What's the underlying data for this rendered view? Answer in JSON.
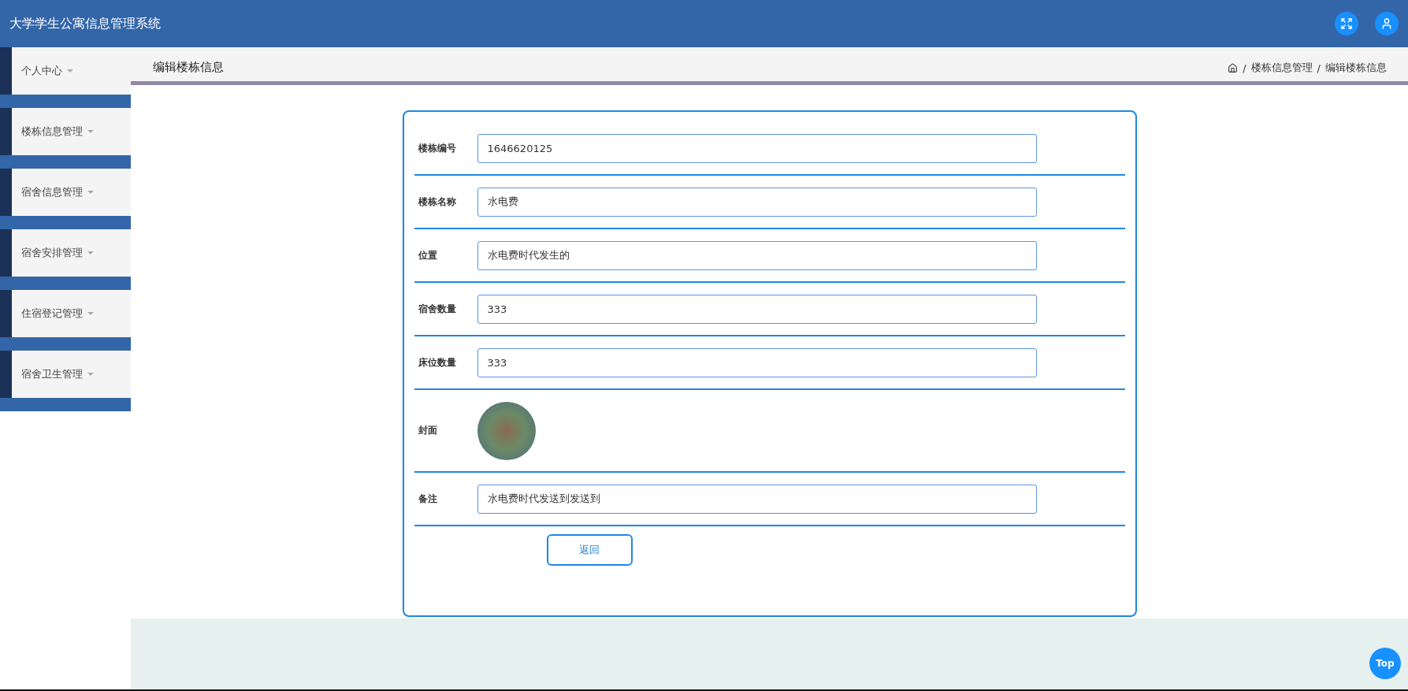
{
  "header": {
    "title": "大学学生公寓信息管理系统"
  },
  "sidebar": {
    "items": [
      {
        "label": "个人中心"
      },
      {
        "label": "楼栋信息管理"
      },
      {
        "label": "宿舍信息管理"
      },
      {
        "label": "宿舍安排管理"
      },
      {
        "label": "住宿登记管理"
      },
      {
        "label": "宿舍卫生管理"
      }
    ]
  },
  "page_title": "编辑楼栋信息",
  "breadcrumb": [
    {
      "separator": "/",
      "label": "楼栋信息管理"
    },
    {
      "separator": "/",
      "label": "编辑楼栋信息"
    }
  ],
  "form": {
    "fields": [
      {
        "kind": "input",
        "label": "楼栋编号",
        "value": "1646620125"
      },
      {
        "kind": "input",
        "label": "楼栋名称",
        "value": "水电费"
      },
      {
        "kind": "input",
        "label": "位置",
        "value": "水电费时代发生的"
      },
      {
        "kind": "input",
        "label": "宿舍数量",
        "value": "333"
      },
      {
        "kind": "input",
        "label": "床位数量",
        "value": "333"
      },
      {
        "kind": "image",
        "label": "封面"
      },
      {
        "kind": "input",
        "label": "备注",
        "value": "水电费时代发送到发送到"
      }
    ],
    "back_button": "返回"
  },
  "top_button": "Top"
}
